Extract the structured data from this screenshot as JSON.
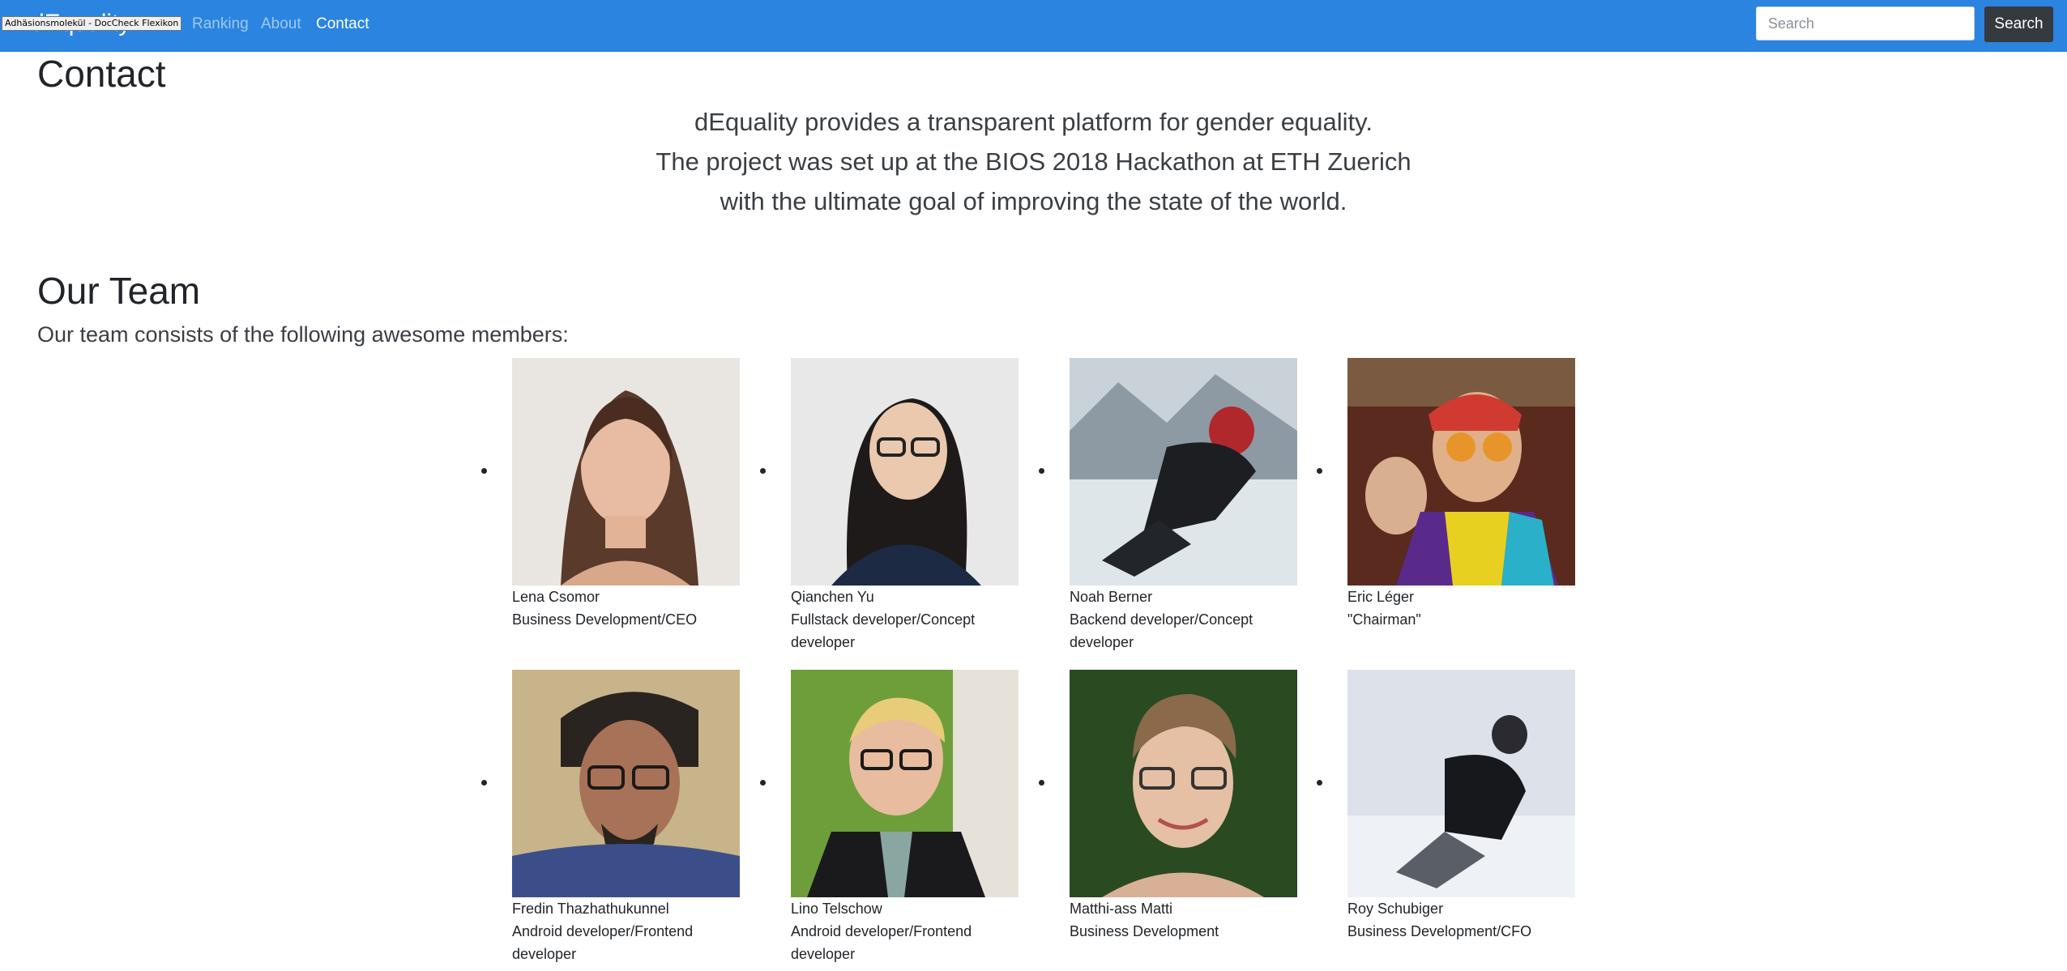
{
  "navbar": {
    "brand": "dEquality",
    "tooltip": "Adhäsionsmolekül - DocCheck Flexikon",
    "links": [
      {
        "label": "Ranking",
        "active": false
      },
      {
        "label": "About",
        "active": false
      },
      {
        "label": "Contact",
        "active": true
      }
    ],
    "search": {
      "placeholder": "Search",
      "value": "",
      "button_label": "Search"
    }
  },
  "page": {
    "title": "Contact",
    "intro": [
      "dEquality provides a transparent platform for gender equality.",
      "The project was set up at the BIOS 2018 Hackathon at ETH Zuerich",
      "with the ultimate goal of improving the state of the world."
    ]
  },
  "team": {
    "title": "Our Team",
    "subtitle": "Our team consists of the following awesome members:",
    "members": [
      {
        "name": "Lena Csomor",
        "role": "Business Development/CEO"
      },
      {
        "name": "Qianchen Yu",
        "role": "Fullstack developer/Concept developer"
      },
      {
        "name": "Noah Berner",
        "role": "Backend developer/Concept developer"
      },
      {
        "name": "Eric Léger",
        "role": "\"Chairman\""
      },
      {
        "name": "Fredin Thazhathukunnel",
        "role": "Android developer/Frontend developer"
      },
      {
        "name": "Lino Telschow",
        "role": "Android developer/Frontend developer"
      },
      {
        "name": "Matthi-ass Matti",
        "role": "Business Development"
      },
      {
        "name": "Roy Schubiger",
        "role": "Business Development/CFO"
      }
    ]
  }
}
